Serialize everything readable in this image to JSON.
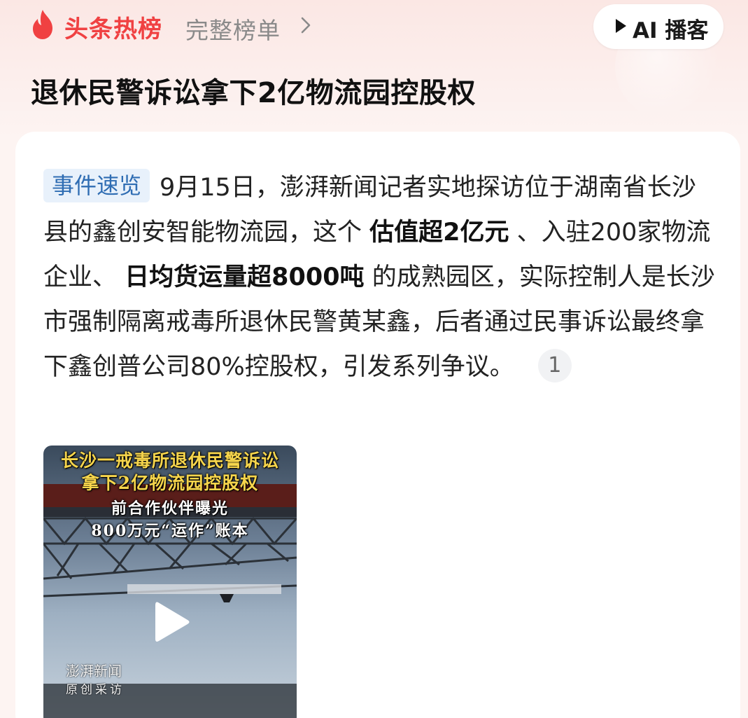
{
  "header": {
    "brand_label": "头条热榜",
    "full_list_label": "完整榜单",
    "ai_podcast_label": "AI 播客",
    "icons": [
      "flame-logo-icon",
      "chevron-right-icon",
      "play-icon"
    ]
  },
  "headline": "退休民警诉讼拿下2亿物流园控股权",
  "summary": {
    "tag": "事件速览",
    "text_1": "9月15日，澎湃新闻记者实地探访位于湖南省长沙县的鑫创安智能物流园，这个 ",
    "bold_1": "估值超2亿元",
    "text_2": " 、入驻200家物流企业、 ",
    "bold_2": "日均货运量超8000吨",
    "text_3": " 的成熟园区，实际控制人是长沙市强制隔离戒毒所退休民警黄某鑫，后者通过民事诉讼最终拿下鑫创普公司80%控股权，引发系列争议。",
    "ref_number": "1"
  },
  "video": {
    "caption_1": "长沙一戒毒所退休民警诉讼",
    "caption_2": "拿下2亿物流园控股权",
    "caption_3": "前合作伙伴曝光",
    "caption_4": "800万元“运作”账本",
    "watermark_1": "澎湃新闻",
    "watermark_2": "原创采访"
  },
  "colors": {
    "brand_red": "#f04142",
    "tag_bg": "#e8f1fb",
    "tag_text": "#2f6db3"
  }
}
